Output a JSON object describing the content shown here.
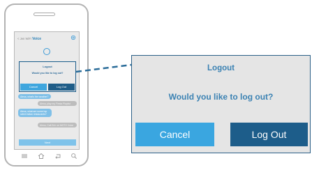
{
  "phone": {
    "header": {
      "back_prefix": "< Jen WiFi",
      "back_title": "Voice"
    },
    "mini_modal": {
      "title": "Logout",
      "message": "Would you like to log out?",
      "cancel_label": "Cancel",
      "logout_label": "Log Out"
    },
    "messages": [
      {
        "text": "Alexa, what's the weather?",
        "from": "user"
      },
      {
        "text": "Alexa, play my Fiesta Playlist",
        "from": "assistant"
      },
      {
        "text": "Alexa, what are some top rated Indian restaurants?",
        "from": "user"
      },
      {
        "text": "Alexa, Call Erin on MOTO Voice",
        "from": "assistant"
      }
    ],
    "next_label": "Next",
    "nav_icons": [
      "menu-icon",
      "home-icon",
      "back-icon",
      "search-icon"
    ]
  },
  "modal": {
    "title": "Logout",
    "message": "Would you like to log out?",
    "cancel_label": "Cancel",
    "logout_label": "Log Out"
  },
  "colors": {
    "accent_light": "#3aa6e0",
    "accent_dark": "#1d5d8a",
    "text_blue": "#3b82b3",
    "modal_bg": "#e5e5e5"
  }
}
